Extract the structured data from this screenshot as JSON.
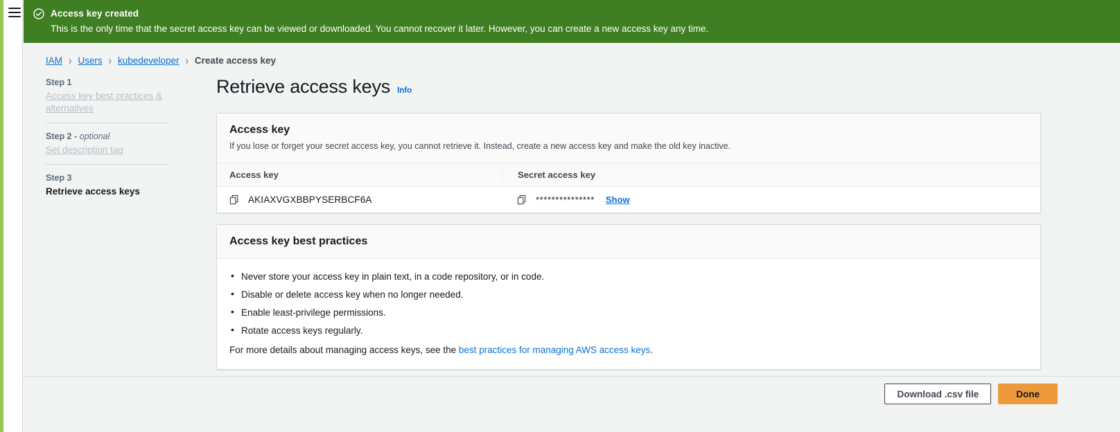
{
  "brand": {
    "accent_lime": "#9ac452",
    "banner_green": "#3f7e23",
    "link_blue": "#0972d3",
    "primary_orange": "#ec9a3c"
  },
  "nav": {
    "menu_icon": "hamburger-menu-icon"
  },
  "banner": {
    "icon": "status-success-circle-check-icon",
    "title": "Access key created",
    "description": "This is the only time that the secret access key can be viewed or downloaded. You cannot recover it later. However, you can create a new access key any time."
  },
  "breadcrumb": {
    "separator": "›",
    "items": [
      {
        "label": "IAM",
        "is_link": true
      },
      {
        "label": "Users",
        "is_link": true
      },
      {
        "label": "kubedeveloper",
        "is_link": true
      },
      {
        "label": "Create access key",
        "is_link": false
      }
    ]
  },
  "wizard": {
    "steps": [
      {
        "step_label": "Step 1",
        "optional_suffix": "",
        "title": "Access key best practices & alternatives",
        "state": "completed"
      },
      {
        "step_label": "Step 2 - ",
        "optional_suffix": "optional",
        "title": "Set description tag",
        "state": "completed"
      },
      {
        "step_label": "Step 3",
        "optional_suffix": "",
        "title": "Retrieve access keys",
        "state": "current"
      }
    ]
  },
  "main": {
    "page_title": "Retrieve access keys",
    "info_link": "Info",
    "access_key_card": {
      "title": "Access key",
      "description": "If you lose or forget your secret access key, you cannot retrieve it. Instead, create a new access key and make the old key inactive.",
      "columns": [
        "Access key",
        "Secret access key"
      ],
      "row": {
        "access_key": "AKIAXVGXBBPYSERBCF6A",
        "secret_access_key_masked": "***************",
        "show_label": "Show",
        "copy_icon": "copy-icon"
      }
    },
    "best_practices_card": {
      "title": "Access key best practices",
      "bullets": [
        "Never store your access key in plain text, in a code repository, or in code.",
        "Disable or delete access key when no longer needed.",
        "Enable least-privilege permissions.",
        "Rotate access keys regularly."
      ],
      "footer_prefix": "For more details about managing access keys, see the ",
      "footer_link": "best practices for managing AWS access keys",
      "footer_suffix": "."
    }
  },
  "footer": {
    "download_button": "Download .csv file",
    "done_button": "Done"
  }
}
